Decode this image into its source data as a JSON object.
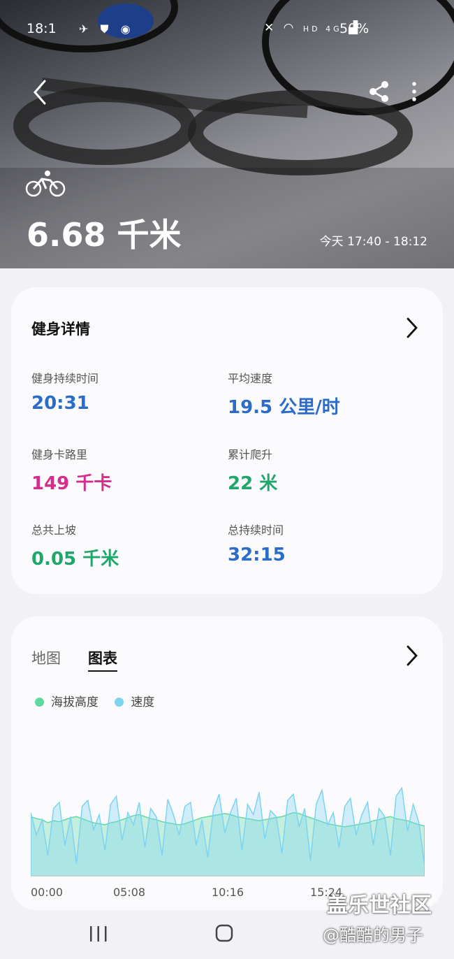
{
  "status_bar": {
    "time": "18:1",
    "network": "HD 4G",
    "battery": "50%"
  },
  "hero": {
    "activity_icon": "bicycle-icon",
    "distance": "6.68 千米",
    "time_range": "今天 17:40 - 18:12"
  },
  "details": {
    "title": "健身详情",
    "stats": [
      {
        "label": "健身持续时间",
        "value": "20:31",
        "color": "#2b6bc9"
      },
      {
        "label": "平均速度",
        "value": "19.5 公里/时",
        "color": "#2b6bc9"
      },
      {
        "label": "健身卡路里",
        "value": "149 千卡",
        "color": "#d42e8c"
      },
      {
        "label": "累计爬升",
        "value": "22 米",
        "color": "#1fa66b"
      },
      {
        "label": "总共上坡",
        "value": "0.05 千米",
        "color": "#1fa66b"
      },
      {
        "label": "总持续时间",
        "value": "32:15",
        "color": "#2b6bc9"
      }
    ]
  },
  "chart_card": {
    "tabs": [
      "地图",
      "图表"
    ],
    "active_tab": "图表",
    "legend": [
      {
        "name": "海拔高度",
        "color": "#5fd8a2"
      },
      {
        "name": "速度",
        "color": "#7dd3f0"
      }
    ],
    "x_ticks": [
      "00:00",
      "05:08",
      "10:16",
      "15:24"
    ]
  },
  "chart_data": {
    "type": "area",
    "x_ticks": [
      "00:00",
      "05:08",
      "10:16",
      "15:24"
    ],
    "series": [
      {
        "name": "海拔高度",
        "color": "#5fd8a2",
        "values": [
          58,
          56,
          55,
          52,
          54,
          53,
          55,
          57,
          58,
          56,
          54,
          52,
          51,
          50,
          52,
          53,
          55,
          57,
          59,
          60,
          58,
          56,
          55,
          53,
          52,
          51,
          50,
          51,
          53,
          55,
          57,
          58,
          59,
          60,
          61,
          60,
          58,
          57,
          56,
          55,
          54,
          55,
          56,
          57,
          58,
          60,
          62,
          61,
          59,
          57,
          55,
          53,
          51,
          50,
          49,
          48,
          49,
          50,
          51,
          52,
          54,
          55,
          57,
          58,
          56,
          55,
          54,
          52,
          50,
          49
        ]
      },
      {
        "name": "速度",
        "color": "#7dd3f0",
        "values": [
          62,
          40,
          55,
          20,
          66,
          72,
          30,
          58,
          12,
          68,
          74,
          45,
          60,
          25,
          70,
          78,
          35,
          62,
          50,
          72,
          28,
          66,
          58,
          20,
          75,
          60,
          40,
          68,
          72,
          30,
          55,
          18,
          65,
          80,
          42,
          62,
          76,
          25,
          70,
          60,
          82,
          36,
          64,
          58,
          22,
          74,
          80,
          48,
          66,
          15,
          70,
          84,
          50,
          62,
          28,
          68,
          76,
          40,
          60,
          72,
          30,
          66,
          58,
          20,
          78,
          86,
          44,
          70,
          52,
          10
        ]
      }
    ]
  },
  "nav": {
    "recent_icon": "recent-apps-icon",
    "home_icon": "home-icon"
  },
  "watermark": {
    "line1": "盖乐世社区",
    "line2": "@酷酷的男子"
  }
}
